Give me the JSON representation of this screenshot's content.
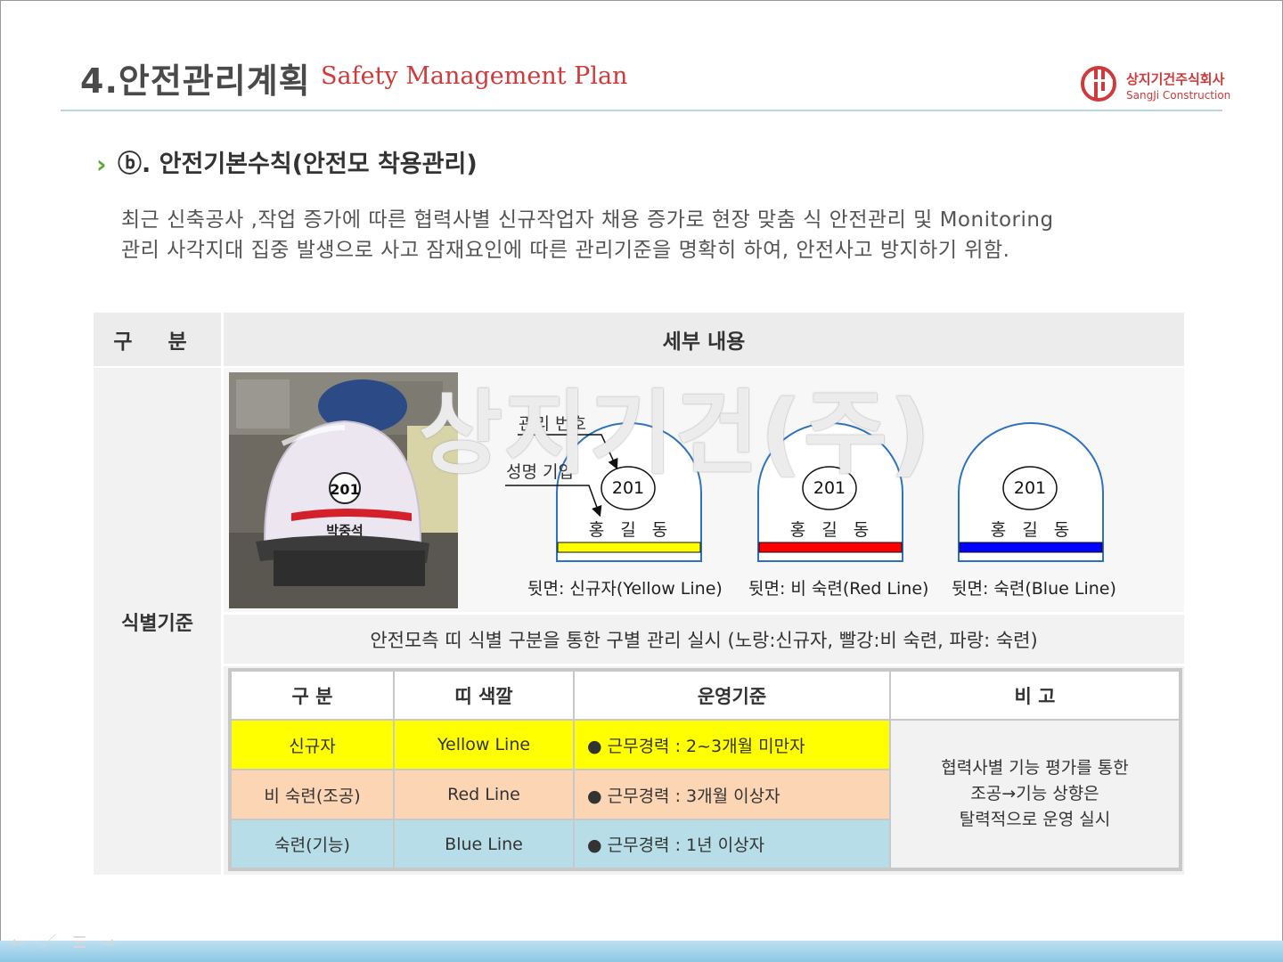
{
  "header": {
    "title": "4.안전관리계획",
    "subtitle": "Safety Management Plan",
    "logo_kr": "상지기건주식회사",
    "logo_en": "SangJi Construction"
  },
  "section": {
    "arrow": "›",
    "title": "ⓑ. 안전기본수칙(안전모 착용관리)"
  },
  "intro": {
    "line1": "최근 신축공사 ,작업 증가에 따른 협력사별 신규작업자 채용 증가로 현장 맞춤 식 안전관리 및 Monitoring",
    "line2": "관리 사각지대 집중 발생으로  사고 잠재요인에 따른 관리기준을 명확히 하여, 안전사고 방지하기 위함."
  },
  "main_table": {
    "header_category": "구 분",
    "header_detail": "세부 내용",
    "category": "식별기준",
    "description": "안전모측 띠 식별 구분을 통한 구별 관리 실시 (노랑:신규자, 빨강:비 숙련, 파랑: 숙련)"
  },
  "photo": {
    "helmet_number": "201",
    "helmet_name": "박중석"
  },
  "diagram": {
    "label_number": "관리 번호",
    "label_name": "성명 기입",
    "helmets": [
      {
        "number": "201",
        "name": "홍 길 동",
        "color": "#ffff00",
        "caption": "뒷면: 신규자(Yellow Line)"
      },
      {
        "number": "201",
        "name": "홍 길 동",
        "color": "#ff0000",
        "caption": "뒷면: 비 숙련(Red Line)"
      },
      {
        "number": "201",
        "name": "홍 길 동",
        "color": "#0000ff",
        "caption": "뒷면: 숙련(Blue Line)"
      }
    ]
  },
  "watermark": "상지기건(주)",
  "sub_table": {
    "headers": [
      "구 분",
      "띠 색깔",
      "운영기준",
      "비 고"
    ],
    "rows": [
      {
        "category": "신규자",
        "color": "Yellow Line",
        "criteria": "● 근무경력 : 2~3개월 미만자"
      },
      {
        "category": "비 숙련(조공)",
        "color": "Red Line",
        "criteria": "● 근무경력 : 3개월 이상자"
      },
      {
        "category": "숙련(기능)",
        "color": "Blue Line",
        "criteria": "● 근무경력 : 1년 이상자"
      }
    ],
    "note_line1": "협력사별 기능 평가를 통한",
    "note_line2": "조공→기능 상향은",
    "note_line3": "탈력적으로 운영 실시"
  },
  "nav_icons": [
    "arrow-left-icon",
    "pen-icon",
    "menu-icon",
    "arrow-right-icon"
  ],
  "nav": {
    "prev": "⇦",
    "pen": "／",
    "menu": "☰",
    "next": "⇨"
  },
  "colors": {
    "accent_red": "#d03a3a",
    "accent_green": "#5aa832",
    "yellow": "#ffff00",
    "orange": "#fcd5b4",
    "blue": "#b7dee8"
  }
}
